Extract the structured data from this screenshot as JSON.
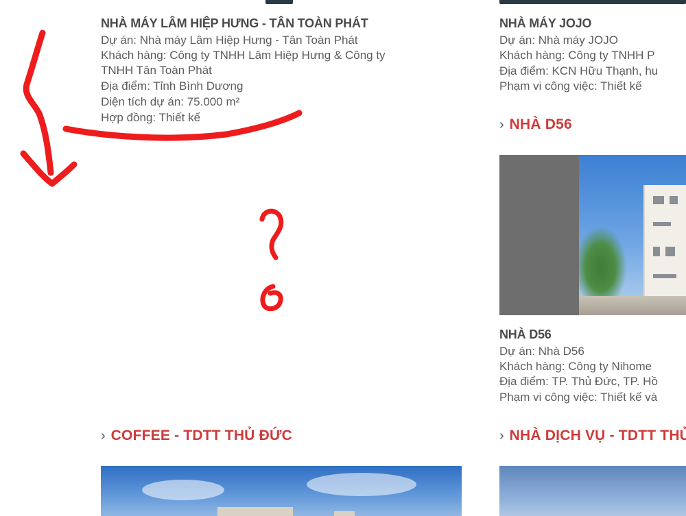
{
  "left_column": {
    "project": {
      "title": "NHÀ MÁY LÂM HIỆP HƯNG - TÂN TOÀN PHÁT",
      "lines": [
        "Dự án: Nhà máy Lâm Hiệp Hưng - Tân Toàn Phát",
        "Khách hàng: Công ty TNHH Lâm Hiệp Hưng & Công ty",
        "TNHH Tân Toàn Phát",
        "Địa điểm: Tỉnh Bình Dương",
        "Diện tích dự án: 75.000 m²",
        "Hợp đồng: Thiết kế"
      ]
    },
    "next_section": {
      "heading": "COFFEE - TDTT THỦ ĐỨC",
      "chevron": "›"
    }
  },
  "right_column": {
    "project_jojo": {
      "title": "NHÀ MÁY JOJO",
      "lines": [
        "Dự án: Nhà máy JOJO",
        "Khách hàng: Công ty TNHH P",
        "Địa điểm: KCN Hữu Thạnh, hu",
        "Phạm vi công việc: Thiết kế"
      ]
    },
    "section_d56": {
      "heading": "NHÀ D56",
      "chevron": "›"
    },
    "project_d56": {
      "title": "NHÀ D56",
      "lines": [
        "Dự án: Nhà D56",
        "Khách hàng: Công ty Nihome",
        "Địa điểm: TP. Thủ Đức, TP. Hồ",
        "Phạm vi công việc: Thiết kế và"
      ]
    },
    "next_section": {
      "heading": "NHÀ DỊCH VỤ - TDTT THỦ ĐỨC",
      "chevron": "›"
    }
  },
  "colors": {
    "heading_red": "#cf3a3a",
    "annotation_red": "#ee1c1c",
    "text_gray": "#5c5c5c",
    "title_gray": "#4a4a4a"
  },
  "annotations": {
    "items": [
      "curved-arrow",
      "underline",
      "question-mark"
    ]
  }
}
